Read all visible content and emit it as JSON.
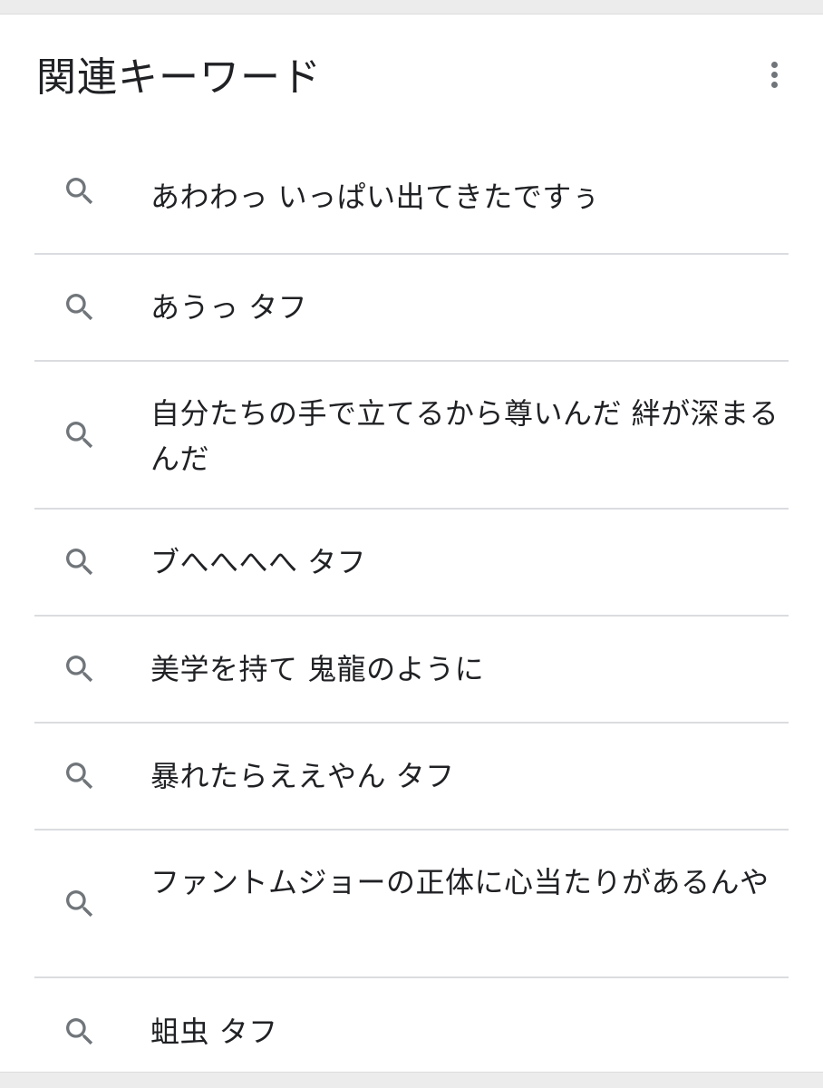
{
  "header": {
    "title": "関連キーワード",
    "menu_icon": "more-vert-icon"
  },
  "keywords": [
    {
      "text": "あわわっ いっぱい出てきたですぅ",
      "icon": "search-icon"
    },
    {
      "text": "あうっ タフ",
      "icon": "search-icon"
    },
    {
      "text": "自分たちの手で立てるから尊いんだ 絆が深まるんだ",
      "icon": "search-icon"
    },
    {
      "text": "ブへへへへ タフ",
      "icon": "search-icon"
    },
    {
      "text": "美学を持て 鬼龍のように",
      "icon": "search-icon"
    },
    {
      "text": "暴れたらええやん タフ",
      "icon": "search-icon"
    },
    {
      "text": "ファントムジョーの正体に心当たりがあるんや",
      "icon": "search-icon"
    },
    {
      "text": "蛆虫 タフ",
      "icon": "search-icon"
    }
  ],
  "colors": {
    "text": "#202124",
    "icon": "#70757a",
    "divider": "#dadce0",
    "page_background": "#ececec",
    "card_background": "#ffffff"
  }
}
